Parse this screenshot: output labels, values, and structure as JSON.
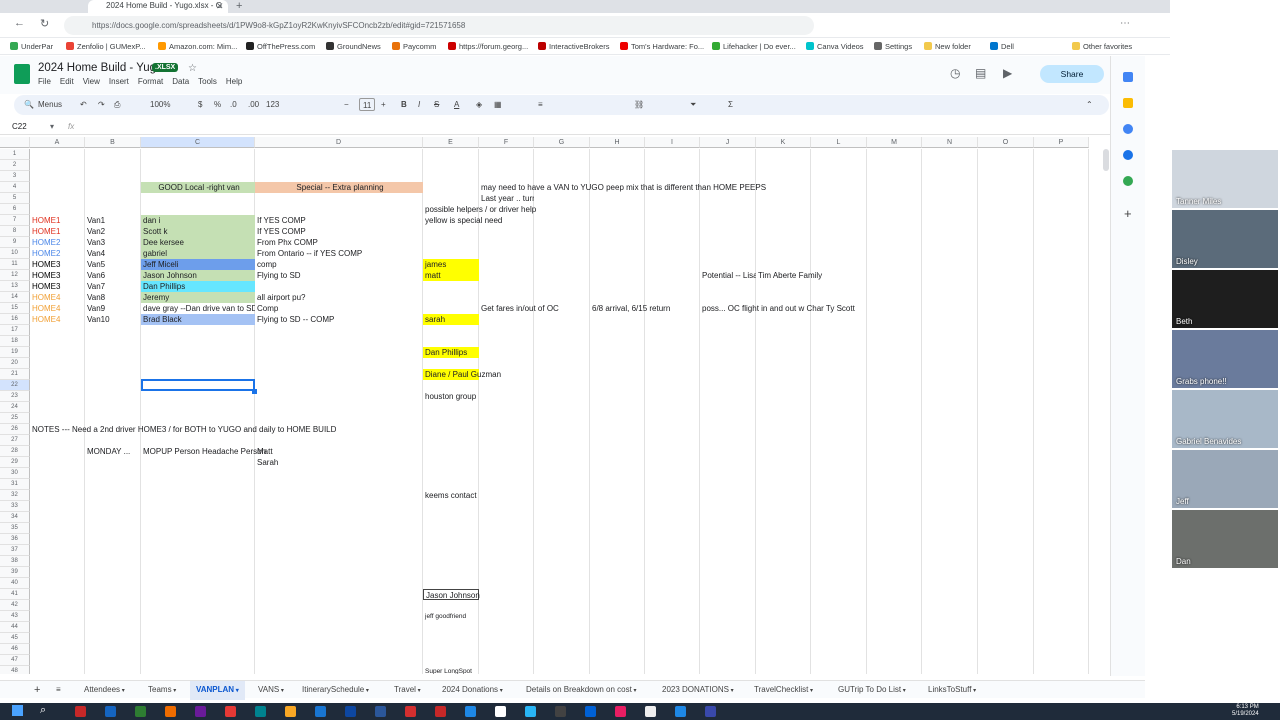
{
  "browser": {
    "tab_title": "2024 Home Build - Yugo.xlsx - G",
    "url": "https://docs.google.com/spreadsheets/d/1PW9o8-kGpZ1oyR2KwKnyivSFCOncb2zb/edit#gid=721571658",
    "bookmarks": [
      "UnderPar",
      "Zenfolio | GUMexP...",
      "Amazon.com: Mim...",
      "OffThePress.com",
      "GroundNews",
      "Paycomm",
      "https://forum.georg...",
      "InteractiveBrokers",
      "Tom's Hardware: Fo...",
      "Lifehacker | Do ever...",
      "Canva Videos",
      "Settings",
      "New folder",
      "Dell",
      "Other favorites"
    ]
  },
  "doc": {
    "title": "2024 Home Build - Yugo",
    "badge": ".XLSX",
    "menu": [
      "File",
      "Edit",
      "View",
      "Insert",
      "Format",
      "Data",
      "Tools",
      "Help"
    ],
    "share_label": "Share"
  },
  "toolbar": {
    "menus": "Menus",
    "zoom": "100%",
    "currency": "$",
    "percent": "%",
    "dec1": ".0",
    "dec2": ".00",
    "fmt": "123",
    "font_size": "11"
  },
  "formula": {
    "cell_ref": "C22",
    "fx": "fx"
  },
  "columns": [
    "A",
    "B",
    "C",
    "D",
    "E",
    "F",
    "G",
    "H",
    "I",
    "J",
    "K",
    "L",
    "M",
    "N",
    "O",
    "P"
  ],
  "rows": 48,
  "cells": {
    "c4": "GOOD Local -right van",
    "d4": "Special -- Extra planning",
    "f4": "may need to have a VAN to YUGO peep mix that is different than HOME PEEPS",
    "f5": "Last year .. turned in some VANS in SanDiego Enterprise  -- E",
    "e6": "possible helpers / or driver help",
    "a7": "HOME1",
    "b7": "Van1",
    "c7": "dan i",
    "d7": "If YES COMP",
    "e7": "yellow is special need",
    "a8": "HOME1",
    "b8": "Van2",
    "c8": "Scott k",
    "d8": "If YES COMP",
    "a9": "HOME2",
    "b9": "Van3",
    "c9": "Dee kersee",
    "d9": "From Phx COMP",
    "a10": "HOME2",
    "b10": "Van4",
    "c10": "gabriel",
    "d10": "From Ontario -- if YES COMP",
    "a11": "HOME3",
    "b11": "Van5",
    "c11": "Jeff Miceli",
    "d11": "comp",
    "e11": "james",
    "a12": "HOME3",
    "b12": "Van6",
    "c12": "Jason Johnson",
    "d12": "Flying to SD",
    "e12": "matt",
    "j12": "Potential -- Lisa",
    "k12": "Tim Aberte Family",
    "a13": "HOME3",
    "b13": "Van7",
    "c13": "Dan Phillips",
    "a14": "HOME4",
    "b14": "Van8",
    "c14": "Jeremy",
    "d14": "all airport pu?",
    "a15": "HOME4",
    "b15": "Van9",
    "c15": "dave gray --Dan drive van to SD",
    "d15": "Comp",
    "f15": "Get fares in/out of OC",
    "h15": "6/8 arrival, 6/15 return",
    "j15": "poss... OC flight in and out w Char Ty Scott",
    "a16": "HOME4",
    "b16": "Van10",
    "c16": "Brad Black",
    "d16": "Flying to SD  -- COMP",
    "e16": "sarah",
    "e19": "Dan Phillips",
    "e21": "Diane / Paul Guzman",
    "e23": "houston group",
    "a26": "NOTES --- Need a 2nd driver HOME3 / for BOTH to YUGO and daily to HOME BUILD",
    "b28": "MONDAY ...",
    "c28": "MOPUP Person Headache Person",
    "d28": "Matt",
    "d29": "Sarah",
    "e32": "keems contact",
    "e41": "Jason Johnson",
    "e43": "jeff goodfriend",
    "e48": "Super LongSpot"
  },
  "colors": {
    "home1": "#e0301e",
    "home2": "#4a86e8",
    "home3": "#000000",
    "home4": "#f1a035",
    "green": "#c5e0b4",
    "peach": "#f4c7a9",
    "yellow": "#ffff00",
    "blue": "#6d9eeb",
    "cyan": "#66e6ff",
    "lightblue": "#a4c2f4"
  },
  "sheet_tabs": [
    "Attendees",
    "Teams",
    "VANPLAN",
    "VANS",
    "ItinerarySchedule",
    "Travel",
    "2024 Donations",
    "Details on Breakdown on cost",
    "2023 DONATIONS",
    "TravelChecklist",
    "GUTrip To Do List",
    "LinksToStuff"
  ],
  "active_tab": "VANPLAN",
  "participants": [
    "Tanner Miles",
    "Disley",
    "Beth",
    "Grabs phone!!",
    "Gabriel Benavides",
    "Jeff",
    "Dan"
  ],
  "clock": {
    "time": "6:13 PM",
    "date": "5/19/2024"
  }
}
